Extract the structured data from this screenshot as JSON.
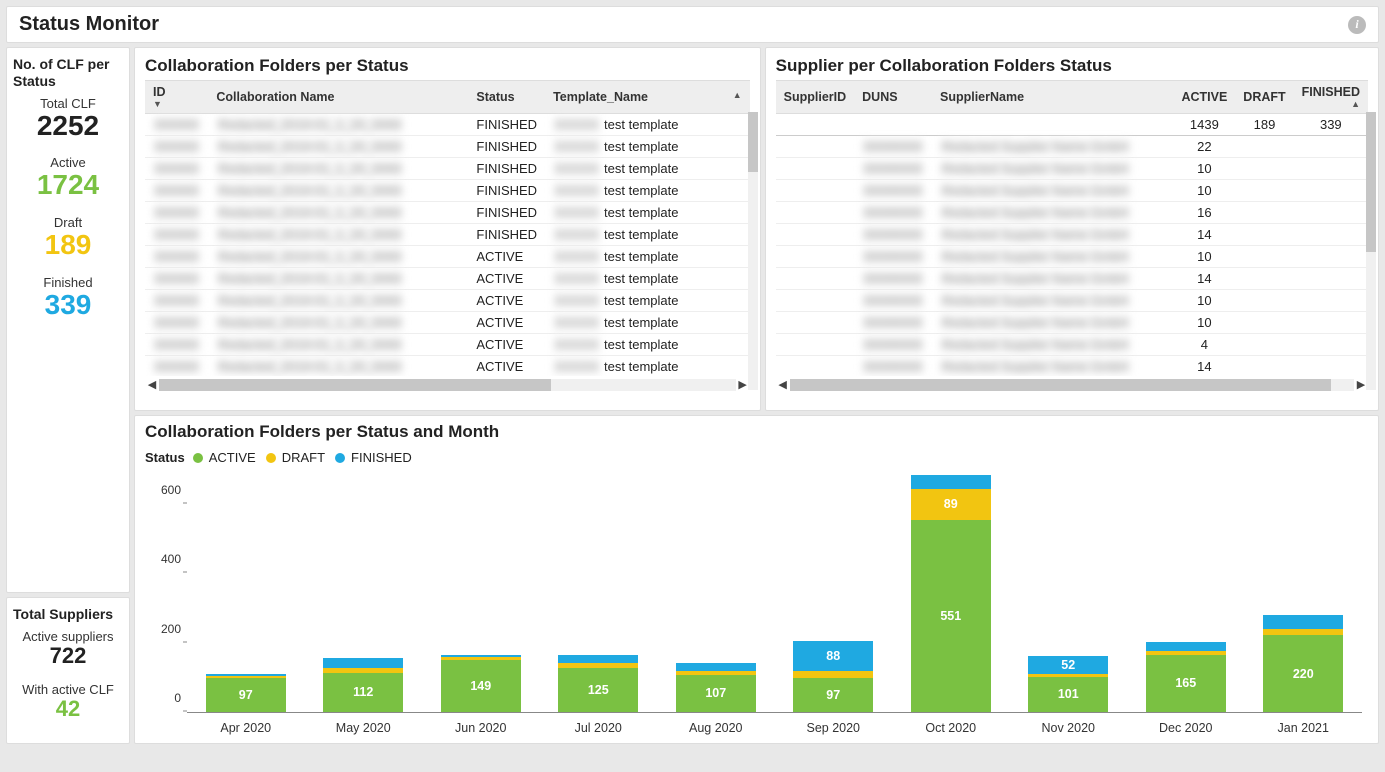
{
  "header": {
    "title": "Status Monitor"
  },
  "kpi_clf": {
    "card_title": "No. of CLF per Status",
    "total_label": "Total CLF",
    "total_value": "2252",
    "active_label": "Active",
    "active_value": "1724",
    "draft_label": "Draft",
    "draft_value": "189",
    "finished_label": "Finished",
    "finished_value": "339"
  },
  "kpi_suppliers": {
    "card_title": "Total Suppliers",
    "active_label": "Active suppliers",
    "active_value": "722",
    "with_clf_label": "With active CLF",
    "with_clf_value": "42"
  },
  "folders_table": {
    "title": "Collaboration Folders per Status",
    "headers": {
      "id": "ID",
      "name": "Collaboration Name",
      "status": "Status",
      "template": "Template_Name"
    },
    "rows": [
      {
        "status": "FINISHED",
        "template": "test template"
      },
      {
        "status": "FINISHED",
        "template": "test template"
      },
      {
        "status": "FINISHED",
        "template": "test template"
      },
      {
        "status": "FINISHED",
        "template": "test template"
      },
      {
        "status": "FINISHED",
        "template": "test template"
      },
      {
        "status": "FINISHED",
        "template": "test template"
      },
      {
        "status": "ACTIVE",
        "template": "test template"
      },
      {
        "status": "ACTIVE",
        "template": "test template"
      },
      {
        "status": "ACTIVE",
        "template": "test template"
      },
      {
        "status": "ACTIVE",
        "template": "test template"
      },
      {
        "status": "ACTIVE",
        "template": "test template"
      },
      {
        "status": "ACTIVE",
        "template": "test template"
      }
    ]
  },
  "supplier_table": {
    "title": "Supplier per Collaboration Folders Status",
    "headers": {
      "supplier_id": "SupplierID",
      "duns": "DUNS",
      "name": "SupplierName",
      "active": "ACTIVE",
      "draft": "DRAFT",
      "finished": "FINISHED"
    },
    "totals": {
      "active": "1439",
      "draft": "189",
      "finished": "339"
    },
    "rows": [
      {
        "active": "22"
      },
      {
        "active": "10"
      },
      {
        "active": "10"
      },
      {
        "active": "16"
      },
      {
        "active": "14"
      },
      {
        "active": "10"
      },
      {
        "active": "14"
      },
      {
        "active": "10"
      },
      {
        "active": "10"
      },
      {
        "active": "4"
      },
      {
        "active": "14"
      }
    ]
  },
  "chart": {
    "title": "Collaboration Folders per Status and Month",
    "legend_label": "Status",
    "legend": {
      "active": "ACTIVE",
      "draft": "DRAFT",
      "finished": "FINISHED"
    },
    "yticks": [
      0,
      200,
      400,
      600
    ]
  },
  "chart_data": {
    "type": "bar",
    "title": "Collaboration Folders per Status and Month",
    "xlabel": "",
    "ylabel": "",
    "ylim": [
      0,
      700
    ],
    "categories": [
      "Apr 2020",
      "May 2020",
      "Jun 2020",
      "Jul 2020",
      "Aug 2020",
      "Sep 2020",
      "Oct 2020",
      "Nov 2020",
      "Dec 2020",
      "Jan 2021"
    ],
    "series": [
      {
        "name": "ACTIVE",
        "values": [
          97,
          112,
          149,
          125,
          107,
          97,
          551,
          101,
          165,
          220
        ],
        "labels": [
          "97",
          "112",
          "149",
          "125",
          "107",
          "97",
          "551",
          "101",
          "165",
          "220"
        ]
      },
      {
        "name": "DRAFT",
        "values": [
          5,
          15,
          8,
          15,
          10,
          20,
          89,
          8,
          10,
          18
        ],
        "labels": [
          "",
          "",
          "",
          "",
          "",
          "",
          "89",
          "",
          "",
          ""
        ]
      },
      {
        "name": "FINISHED",
        "values": [
          8,
          28,
          8,
          25,
          25,
          88,
          40,
          52,
          25,
          40
        ],
        "labels": [
          "",
          "",
          "",
          "",
          "",
          "88",
          "",
          "52",
          "",
          ""
        ]
      }
    ]
  }
}
